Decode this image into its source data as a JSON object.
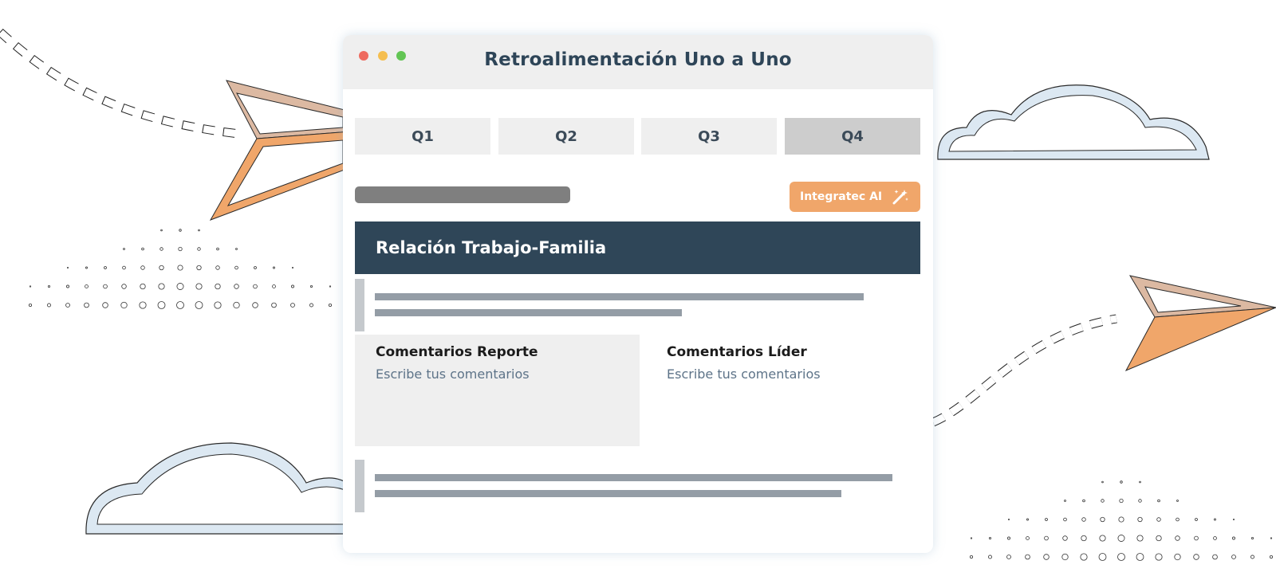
{
  "window": {
    "title": "Retroalimentación Uno a Uno"
  },
  "tabs": [
    {
      "label": "Q1",
      "active": false
    },
    {
      "label": "Q2",
      "active": false
    },
    {
      "label": "Q3",
      "active": false
    },
    {
      "label": "Q4",
      "active": true
    }
  ],
  "ai_button": {
    "label": "Integratec AI",
    "icon": "magic-wand-icon"
  },
  "section": {
    "title": "Relación Trabajo-Familia"
  },
  "comments": {
    "report": {
      "title": "Comentarios Reporte",
      "placeholder": "Escribe tus comentarios"
    },
    "leader": {
      "title": "Comentarios Líder",
      "placeholder": "Escribe tus comentarios"
    }
  },
  "colors": {
    "accent": "#f0a66a",
    "header_bg": "#2f4658",
    "title_text": "#2e4558",
    "active_tab": "#cdcdcd",
    "cloud_fill": "#dce8f2"
  }
}
